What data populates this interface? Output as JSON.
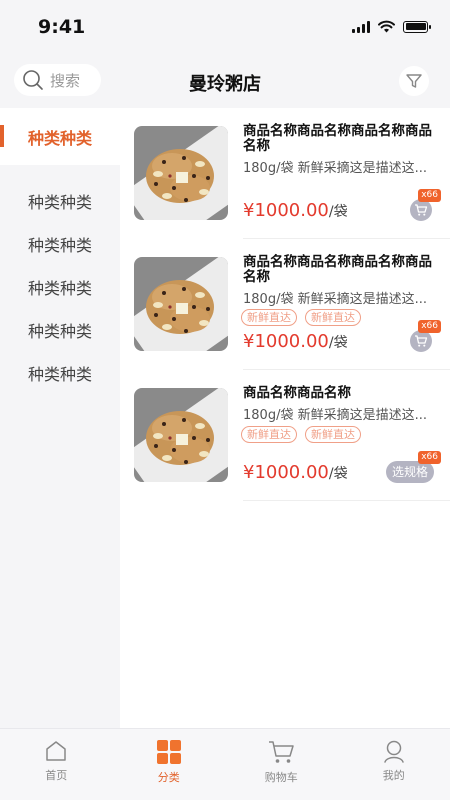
{
  "status_bar": {
    "time": "9:41"
  },
  "header": {
    "search_placeholder": "搜索",
    "title": "曼玲粥店"
  },
  "sidebar": {
    "items": [
      {
        "label": "种类种类",
        "active": true
      },
      {
        "label": "种类种类"
      },
      {
        "label": "种类种类"
      },
      {
        "label": "种类种类"
      },
      {
        "label": "种类种类"
      },
      {
        "label": "种类种类"
      }
    ]
  },
  "products": [
    {
      "name": "商品名称商品名称商品名称商品名称",
      "desc": "180g/袋 新鲜采摘这是描述这...",
      "price": "¥1000.00",
      "unit": "/袋",
      "badge": "x66",
      "action": "cart"
    },
    {
      "name": "商品名称商品名称商品名称商品名称",
      "desc": "180g/袋 新鲜采摘这是描述这...",
      "tags": [
        "新鲜直达",
        "新鲜直达"
      ],
      "price": "¥1000.00",
      "unit": "/袋",
      "badge": "x66",
      "action": "cart"
    },
    {
      "name": "商品名称商品名称",
      "desc": "180g/袋 新鲜采摘这是描述这...",
      "tags": [
        "新鲜直达",
        "新鲜直达"
      ],
      "price": "¥1000.00",
      "unit": "/袋",
      "badge": "x66",
      "action": "spec",
      "spec_label": "选规格"
    }
  ],
  "tabbar": {
    "items": [
      {
        "label": "首页",
        "icon": "home-icon"
      },
      {
        "label": "分类",
        "icon": "category-icon",
        "active": true
      },
      {
        "label": "购物车",
        "icon": "cart-icon"
      },
      {
        "label": "我的",
        "icon": "profile-icon"
      }
    ]
  },
  "colors": {
    "accent": "#e2622c",
    "price": "#e33b2e",
    "tag": "#f0a088",
    "badge": "#f0632c"
  }
}
